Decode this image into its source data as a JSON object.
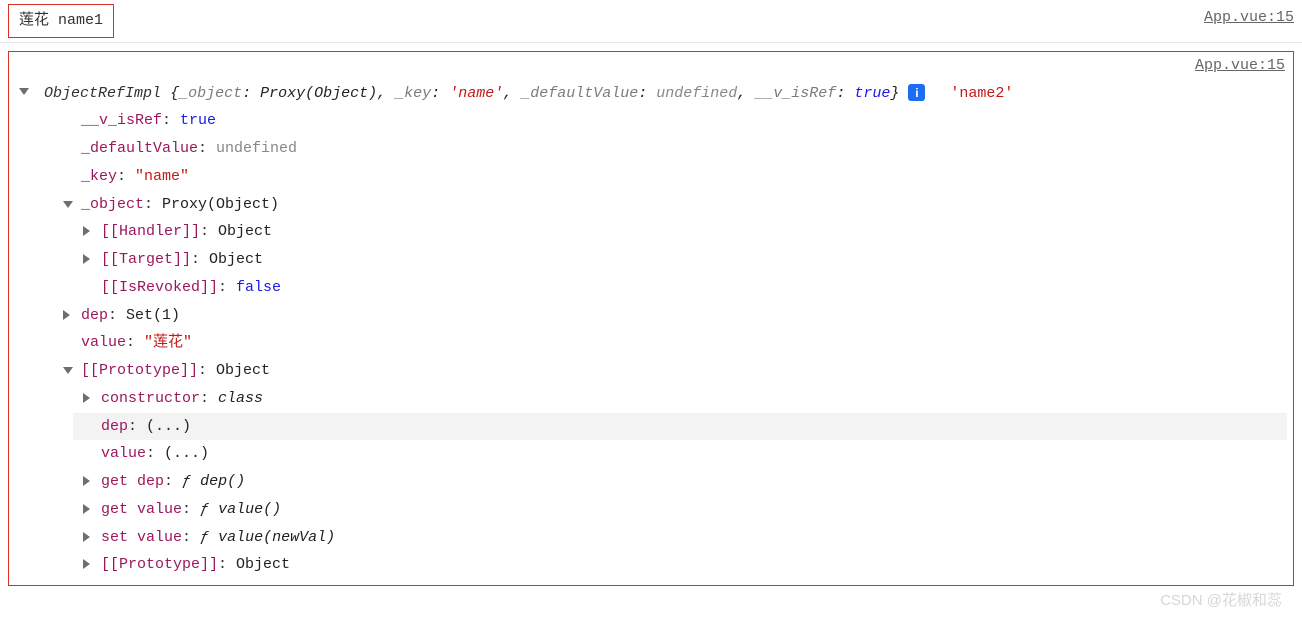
{
  "row1": {
    "text1": "莲花",
    "text2": "name1",
    "source": "App.vue:15"
  },
  "row2": {
    "source": "App.vue:15",
    "className": "ObjectRefImpl",
    "preview": {
      "k1": "_object",
      "v1": "Proxy(Object)",
      "k2": "_key",
      "v2": "'name'",
      "k3": "_defaultValue",
      "v3": "undefined",
      "k4": "__v_isRef",
      "v4": "true"
    },
    "trailing": "'name2'",
    "props": {
      "p1k": "__v_isRef",
      "p1v": "true",
      "p2k": "_defaultValue",
      "p2v": "undefined",
      "p3k": "_key",
      "p3v": "\"name\"",
      "p4k": "_object",
      "p4v": "Proxy(Object)",
      "p4a_k": "[[Handler]]",
      "p4a_v": "Object",
      "p4b_k": "[[Target]]",
      "p4b_v": "Object",
      "p4c_k": "[[IsRevoked]]",
      "p4c_v": "false",
      "p5k": "dep",
      "p5v": "Set(1)",
      "p6k": "value",
      "p6v": "\"莲花\"",
      "p7k": "[[Prototype]]",
      "p7v": "Object",
      "p7a_k": "constructor",
      "p7a_v": "class",
      "p7b_k": "dep",
      "p7b_v": "(...)",
      "p7c_k": "value",
      "p7c_v": "(...)",
      "p7d_k": "get dep",
      "p7d_f": "ƒ",
      "p7d_v": "dep()",
      "p7e_k": "get value",
      "p7e_f": "ƒ",
      "p7e_v": "value()",
      "p7f_k": "set value",
      "p7f_f": "ƒ",
      "p7f_v": "value(newVal)",
      "p7g_k": "[[Prototype]]",
      "p7g_v": "Object"
    }
  },
  "info_icon_label": "i",
  "watermark": "CSDN @花椒和蕊"
}
